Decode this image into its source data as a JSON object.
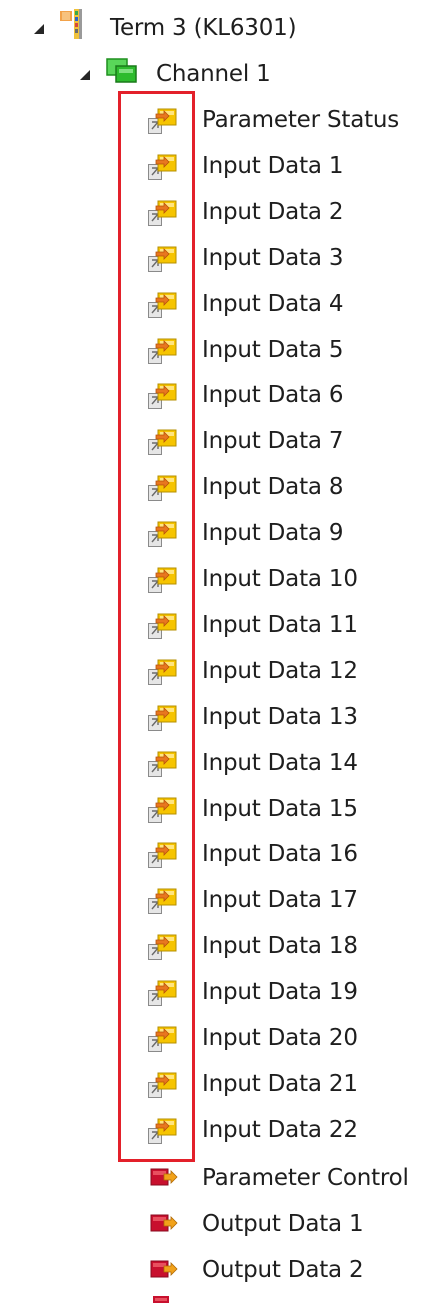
{
  "tree": {
    "term": {
      "label": "Term 3 (KL6301)",
      "icon": "terminal-module-icon",
      "expanded": true
    },
    "channel": {
      "label": "Channel 1",
      "icon": "channel-green-blocks-icon",
      "expanded": true
    },
    "input_items": [
      {
        "label": "Parameter Status",
        "icon": "input-variable-icon"
      },
      {
        "label": "Input Data 1",
        "icon": "input-variable-icon"
      },
      {
        "label": "Input Data 2",
        "icon": "input-variable-icon"
      },
      {
        "label": "Input Data 3",
        "icon": "input-variable-icon"
      },
      {
        "label": "Input Data 4",
        "icon": "input-variable-icon"
      },
      {
        "label": "Input Data 5",
        "icon": "input-variable-icon"
      },
      {
        "label": "Input Data 6",
        "icon": "input-variable-icon"
      },
      {
        "label": "Input Data 7",
        "icon": "input-variable-icon"
      },
      {
        "label": "Input Data 8",
        "icon": "input-variable-icon"
      },
      {
        "label": "Input Data 9",
        "icon": "input-variable-icon"
      },
      {
        "label": "Input Data 10",
        "icon": "input-variable-icon"
      },
      {
        "label": "Input Data 11",
        "icon": "input-variable-icon"
      },
      {
        "label": "Input Data 12",
        "icon": "input-variable-icon"
      },
      {
        "label": "Input Data 13",
        "icon": "input-variable-icon"
      },
      {
        "label": "Input Data 14",
        "icon": "input-variable-icon"
      },
      {
        "label": "Input Data 15",
        "icon": "input-variable-icon"
      },
      {
        "label": "Input Data 16",
        "icon": "input-variable-icon"
      },
      {
        "label": "Input Data 17",
        "icon": "input-variable-icon"
      },
      {
        "label": "Input Data 18",
        "icon": "input-variable-icon"
      },
      {
        "label": "Input Data 19",
        "icon": "input-variable-icon"
      },
      {
        "label": "Input Data 20",
        "icon": "input-variable-icon"
      },
      {
        "label": "Input Data 21",
        "icon": "input-variable-icon"
      },
      {
        "label": "Input Data 22",
        "icon": "input-variable-icon"
      }
    ],
    "output_items": [
      {
        "label": "Parameter Control",
        "icon": "output-variable-icon"
      },
      {
        "label": "Output Data 1",
        "icon": "output-variable-icon"
      },
      {
        "label": "Output Data 2",
        "icon": "output-variable-icon"
      }
    ]
  },
  "colors": {
    "highlight_border": "#e3202a",
    "text": "#1e1e1e",
    "input_icon_yellow": "#f6c400",
    "input_icon_arrow": "#e8771f",
    "output_icon_red": "#c8102e",
    "channel_green": "#2dbb2d"
  }
}
